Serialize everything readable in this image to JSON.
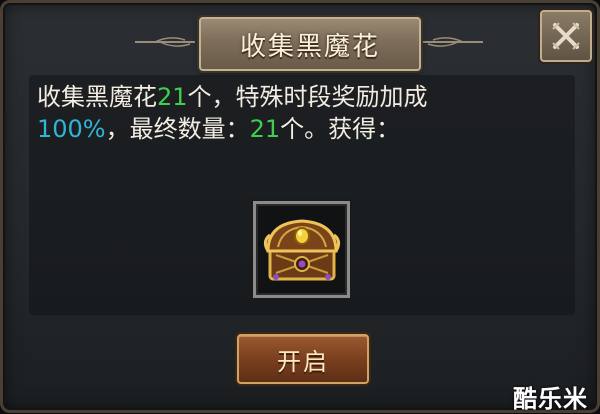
{
  "dialog": {
    "title": "收集黑魔花",
    "message": {
      "part1": "收集黑魔花",
      "count1": "21",
      "part2": "个，特殊时段奖励加成",
      "percent": "100%",
      "part3": "，最终数量：",
      "count2": "21",
      "part4": "个。获得："
    },
    "reward_item": "treasure-chest-icon",
    "open_button_label": "开启",
    "close_icon": "close-x-icon"
  },
  "watermark": "酷乐米",
  "colors": {
    "highlight_green": "#3fcf4f",
    "highlight_blue": "#2fb5d6",
    "button_brown": "#7a3f1e"
  }
}
